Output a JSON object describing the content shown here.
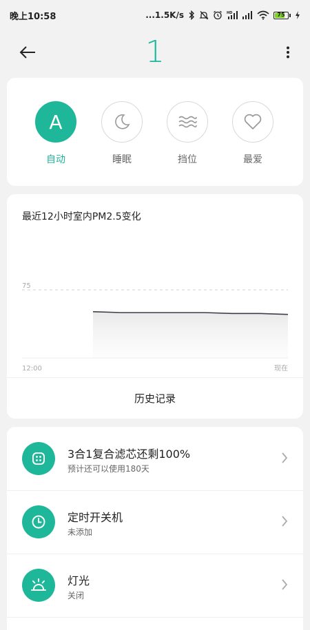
{
  "status_bar": {
    "time": "晚上10:58",
    "net_speed": "...1.5K/s",
    "battery_level": "75",
    "battery_fraction": 0.75,
    "icons": [
      "bluetooth-icon",
      "mute-icon",
      "alarm-icon",
      "hd-signal-icon",
      "signal-icon",
      "wifi-icon",
      "battery-icon",
      "charging-icon"
    ]
  },
  "header": {
    "title": "1"
  },
  "modes": [
    {
      "label": "自动",
      "letter": "A",
      "icon": "auto-icon",
      "active": true
    },
    {
      "label": "睡眠",
      "icon": "moon-icon",
      "active": false
    },
    {
      "label": "挡位",
      "icon": "wind-icon",
      "active": false
    },
    {
      "label": "最爱",
      "icon": "heart-icon",
      "active": false
    }
  ],
  "chart_card": {
    "history_label": "历史记录"
  },
  "chart_data": {
    "type": "line",
    "title": "最近12小时室内PM2.5变化",
    "x_start_label": "12:00",
    "x_end_label": "现在",
    "reference_line": 75,
    "reference_label": "75",
    "ylim": [
      0,
      150
    ],
    "grid": false,
    "series": [
      {
        "values": [
          51,
          50,
          50,
          50,
          50,
          49,
          49,
          48
        ]
      }
    ]
  },
  "list": [
    {
      "title": "3合1复合滤芯还剩100%",
      "subtitle": "预计还可以使用180天",
      "icon": "filter-icon"
    },
    {
      "title": "定时开关机",
      "subtitle": "未添加",
      "icon": "clock-icon"
    },
    {
      "title": "灯光",
      "subtitle": "关闭",
      "icon": "light-icon"
    }
  ],
  "colors": {
    "accent": "#1fb79a",
    "background": "#f2f2f2",
    "card": "#ffffff",
    "battery_fill": "#7ed321"
  }
}
